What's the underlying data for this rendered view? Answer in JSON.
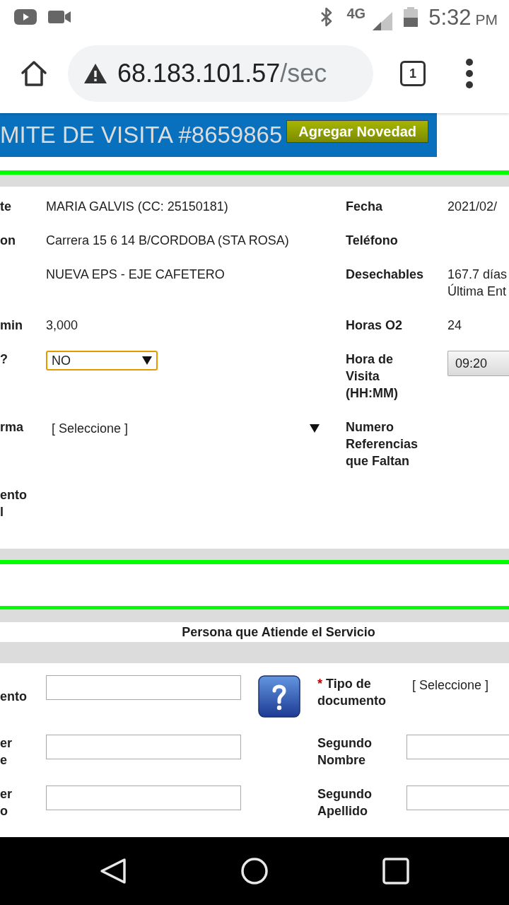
{
  "status_bar": {
    "network": "4G",
    "time": "5:32",
    "meridiem": "PM"
  },
  "browser": {
    "url_host": "68.183.101.57",
    "url_path": "/sec",
    "tab_count": "1"
  },
  "banner": {
    "title": "MITE DE VISITA #8659865",
    "button": "Agregar Novedad"
  },
  "visit_details": {
    "rows": [
      {
        "label": [
          "te"
        ],
        "value": {
          "kind": "text",
          "text": "MARIA GALVIS (CC: 25150181)"
        },
        "side_label": [
          "Fecha"
        ],
        "side_value": {
          "kind": "text",
          "text": "2021/02/"
        }
      },
      {
        "label": [
          "on"
        ],
        "value": {
          "kind": "text",
          "text": "Carrera 15 6 14 B/CORDOBA (STA ROSA)"
        },
        "side_label": [
          "Teléfono"
        ]
      },
      {
        "value": {
          "kind": "text",
          "text": "NUEVA EPS - EJE CAFETERO"
        },
        "side_label": [
          "Desechables"
        ],
        "side_value": {
          "kind": "lines",
          "lines": [
            "167.7 días",
            "Última Ent"
          ]
        }
      },
      {
        "label": [
          "min"
        ],
        "value": {
          "kind": "text",
          "text": "3,000"
        },
        "side_label": [
          "Horas O2"
        ],
        "side_value": {
          "kind": "text",
          "text": "24"
        }
      },
      {
        "label": [
          "?"
        ],
        "value": {
          "kind": "dropdown",
          "text": "NO",
          "focused": true
        },
        "side_label": [
          "Hora de",
          "Visita",
          "(HH:MM)"
        ],
        "side_value": {
          "kind": "time",
          "text": "09:20"
        }
      },
      {
        "label": [
          "rma"
        ],
        "value": {
          "kind": "dropdown",
          "text": "[ Seleccione ]",
          "focused": false
        },
        "side_label": [
          "Numero",
          "Referencias",
          "que Faltan"
        ]
      },
      {
        "label": [
          "ento",
          "l"
        ]
      }
    ]
  },
  "attendant": {
    "title": "Persona que Atiende el Servicio",
    "rows": [
      {
        "label": [
          "ento"
        ],
        "field": {
          "kind": "input"
        },
        "addon": {
          "kind": "help"
        },
        "side_label": {
          "required_mark": "*",
          "lines": [
            "Tipo de",
            "documento"
          ]
        },
        "side_field": {
          "kind": "select",
          "text": "[ Seleccione ]",
          "focused": false
        }
      },
      {
        "label": [
          "er",
          "e"
        ],
        "field": {
          "kind": "input"
        },
        "side_label": {
          "lines": [
            "Segundo",
            "Nombre"
          ]
        },
        "side_field": {
          "kind": "input"
        }
      },
      {
        "label": [
          "er",
          "o"
        ],
        "field": {
          "kind": "input"
        },
        "side_label": {
          "lines": [
            "Segundo",
            "Apellido"
          ]
        },
        "side_field": {
          "kind": "input"
        }
      }
    ]
  }
}
